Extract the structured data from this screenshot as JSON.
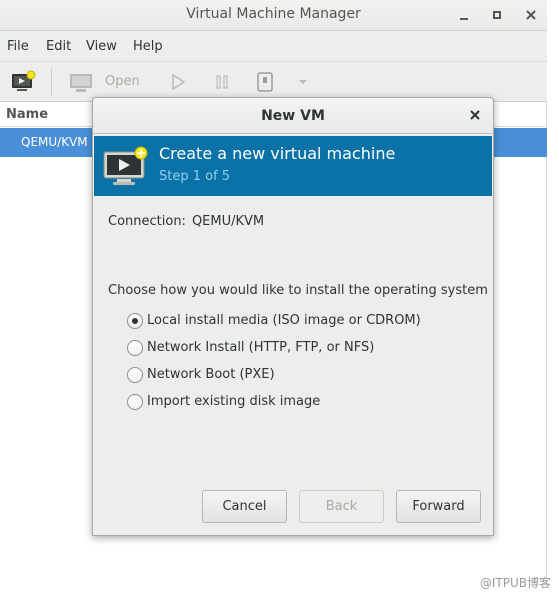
{
  "window": {
    "title": "Virtual Machine Manager",
    "controls": {
      "minimize": "minimize-icon",
      "maximize": "maximize-icon",
      "close": "close-icon"
    }
  },
  "menubar": {
    "items": [
      "File",
      "Edit",
      "View",
      "Help"
    ]
  },
  "toolbar": {
    "new_vm_icon": "new-vm-icon",
    "open_label": "Open",
    "run_icon": "play-icon",
    "pause_icon": "pause-icon",
    "shutdown_icon": "shutdown-icon",
    "dropdown_icon": "dropdown-arrow-icon"
  },
  "vm_list": {
    "column_header": "Name",
    "rows": [
      {
        "name": "QEMU/KVM",
        "selected": true
      }
    ]
  },
  "dialog": {
    "title": "New VM",
    "banner": {
      "title": "Create a new virtual machine",
      "step": "Step 1 of 5",
      "icon": "new-vm-icon",
      "background_color": "#0b72a8"
    },
    "connection_label": "Connection:",
    "connection_value": "QEMU/KVM",
    "install_prompt": "Choose how you would like to install the operating system",
    "install_options": [
      {
        "label": "Local install media (ISO image or CDROM)",
        "selected": true
      },
      {
        "label": "Network Install (HTTP, FTP, or NFS)",
        "selected": false
      },
      {
        "label": "Network Boot (PXE)",
        "selected": false
      },
      {
        "label": "Import existing disk image",
        "selected": false
      }
    ],
    "buttons": {
      "cancel": "Cancel",
      "back": "Back",
      "forward": "Forward"
    }
  },
  "watermark": "@ITPUB博客",
  "colors": {
    "selection": "#4a90d9",
    "banner": "#0b72a8",
    "banner_step_text": "#8fd0f4"
  }
}
